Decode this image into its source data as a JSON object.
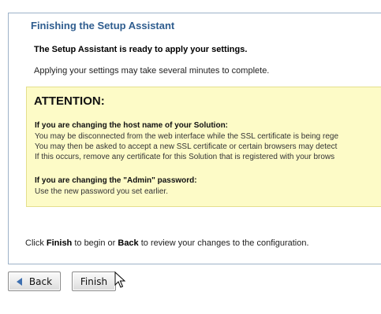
{
  "panel": {
    "title": "Finishing the Setup Assistant",
    "ready_text": "The Setup Assistant is ready to apply your settings.",
    "apply_text": "Applying your settings may take several minutes to complete."
  },
  "attention": {
    "title": "ATTENTION:",
    "host_heading": "If you are changing the host name of your Solution:",
    "host_lines": [
      "You may be disconnected from the web interface while the SSL certificate is being rege",
      "You may then be asked to accept a new SSL certificate or certain browsers may detect",
      "If this occurs, remove any certificate for this Solution that is registered with your brows"
    ],
    "admin_heading": "If you are changing the \"Admin\" password:",
    "admin_line": "Use the new password you set earlier."
  },
  "instructions": {
    "prefix": "Click ",
    "finish_word": "Finish",
    "middle": " to begin or ",
    "back_word": "Back",
    "suffix": " to review your changes to the configuration."
  },
  "buttons": {
    "back_label": "Back",
    "finish_label": "Finish"
  },
  "icons": {
    "back": "triangle-left-icon",
    "cursor": "mouse-pointer-icon"
  },
  "colors": {
    "title": "#2f5d8f",
    "attention_bg": "#fdfbc7",
    "panel_border": "#9db2c8"
  }
}
